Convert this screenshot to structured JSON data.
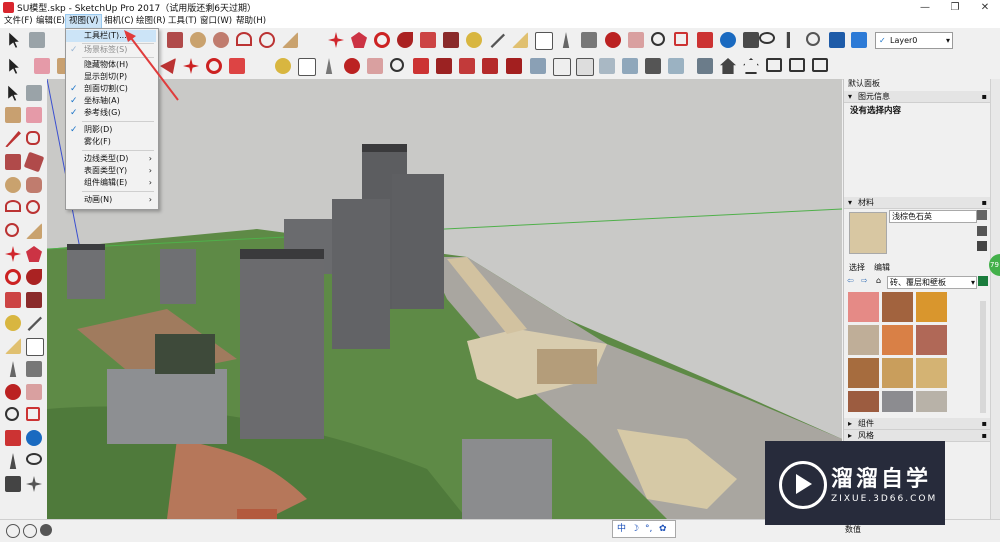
{
  "window": {
    "title": "SU模型.skp - SketchUp Pro 2017（试用版还剩6天过期）",
    "minimize": "—",
    "maximize": "❐",
    "close": "✕"
  },
  "menubar": [
    "文件(F)",
    "编辑(E)",
    "视图(V)",
    "相机(C)",
    "绘图(R)",
    "工具(T)",
    "窗口(W)",
    "帮助(H)"
  ],
  "toolbar": {
    "layer_value": "Layer0"
  },
  "view_menu": {
    "items": [
      {
        "label": "工具栏(T)...",
        "checked": false,
        "submenu": false,
        "highlight": true
      },
      {
        "label": "场景标签(S)",
        "checked": true,
        "submenu": false,
        "disabled": true
      },
      {
        "label": "隐藏物体(H)",
        "checked": false,
        "submenu": false
      },
      {
        "label": "显示剖切(P)",
        "checked": false,
        "submenu": false
      },
      {
        "label": "剖面切割(C)",
        "checked": true,
        "submenu": false
      },
      {
        "label": "坐标轴(A)",
        "checked": true,
        "submenu": false
      },
      {
        "label": "参考线(G)",
        "checked": true,
        "submenu": false
      },
      {
        "label": "阴影(D)",
        "checked": true,
        "submenu": false
      },
      {
        "label": "雾化(F)",
        "checked": false,
        "submenu": false
      },
      {
        "label": "边线类型(D)",
        "checked": false,
        "submenu": true
      },
      {
        "label": "表面类型(Y)",
        "checked": false,
        "submenu": true
      },
      {
        "label": "组件编辑(E)",
        "checked": false,
        "submenu": true
      },
      {
        "label": "动画(N)",
        "checked": false,
        "submenu": true
      }
    ],
    "check_glyph": "✓",
    "submenu_glyph": "›"
  },
  "right_panel": {
    "title": "默认面板",
    "entity_info": {
      "header": "图元信息",
      "empty": "没有选择内容"
    },
    "materials": {
      "header": "材料",
      "material_name": "浅棕色石英",
      "tab_select": "选择",
      "tab_edit": "编辑",
      "category": "砖、覆层和壁板"
    },
    "components_header": "组件",
    "styles_header": "风格",
    "bottom_label": "数值"
  },
  "status_bar": {
    "ime": "中",
    "ime_moon": "☽",
    "ime_dot": "°,",
    "ime_gear": "✿",
    "badge": "79"
  },
  "watermark": {
    "title": "溜溜自学",
    "url": "ZIXUE.3D66.COM"
  },
  "colors": {
    "ground_green": "#5e8a46",
    "sky_grey": "#c9c9c7",
    "arrow_red": "#e03c3c",
    "menu_highlight": "#cce4f7",
    "check_blue": "#1a73c8"
  }
}
